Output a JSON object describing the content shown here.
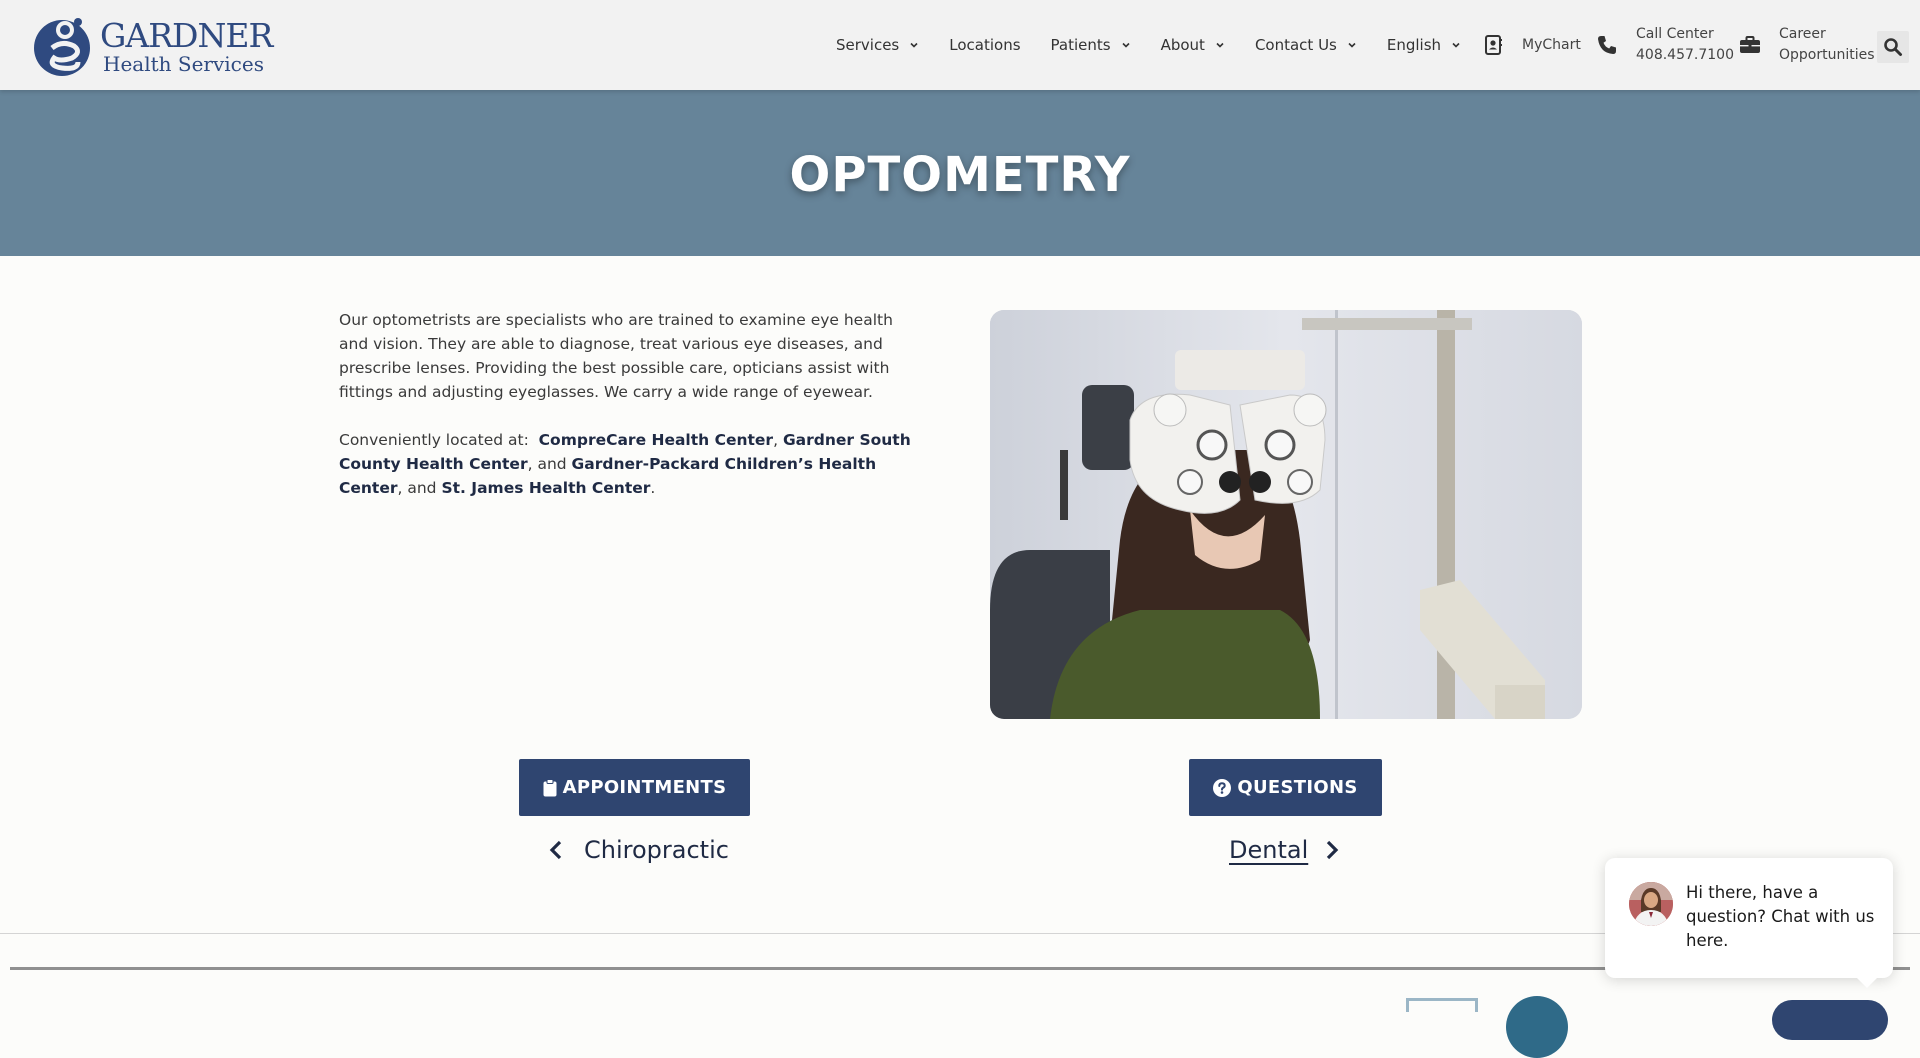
{
  "header": {
    "logo": {
      "line1": "GARDNER",
      "line2": "Health Services"
    },
    "nav": [
      {
        "label": "Services",
        "dropdown": true
      },
      {
        "label": "Locations",
        "dropdown": false
      },
      {
        "label": "Patients",
        "dropdown": true
      },
      {
        "label": "About",
        "dropdown": true
      },
      {
        "label": "Contact Us",
        "dropdown": true
      },
      {
        "label": "English",
        "dropdown": true
      }
    ],
    "utility": {
      "mychart": {
        "label": "MyChart",
        "icon": "address-book-icon"
      },
      "call_center": {
        "label": "Call Center",
        "phone": "408.457.7100",
        "icon": "phone-icon"
      },
      "careers": {
        "line1": "Career",
        "line2": "Opportunities",
        "icon": "briefcase-icon"
      },
      "search": {
        "icon": "search-icon"
      }
    }
  },
  "hero": {
    "title": "OPTOMETRY"
  },
  "content": {
    "intro": "Our optometrists are specialists who are trained to examine eye health and vision. They are able to diagnose, treat various eye diseases, and prescribe lenses. Providing the best possible care, opticians assist with fittings and adjusting eyeglasses. We carry a wide range of eyewear.",
    "located_prefix": "Conveniently located at: ",
    "locations": [
      "CompreCare Health Center",
      "Gardner South County Health Center",
      "Gardner-Packard Children’s Health Center",
      "St. James Health Center"
    ],
    "sep1": ", ",
    "sep2": ", and ",
    "sep3": ", and ",
    "end": "."
  },
  "image": {
    "alt": "Patient having an eye exam with a phoropter"
  },
  "actions": {
    "appointments": {
      "label": "APPOINTMENTS",
      "icon": "clipboard-icon"
    },
    "questions": {
      "label": "QUESTIONS",
      "icon": "question-circle-icon"
    }
  },
  "pagination": {
    "prev": "Chiropractic",
    "next": "Dental"
  },
  "chat": {
    "message": "Hi there, have a question? Chat with us here."
  },
  "colors": {
    "brand_navy": "#2f4570",
    "hero_bg": "#668499",
    "header_bg": "#f2f2f2"
  }
}
